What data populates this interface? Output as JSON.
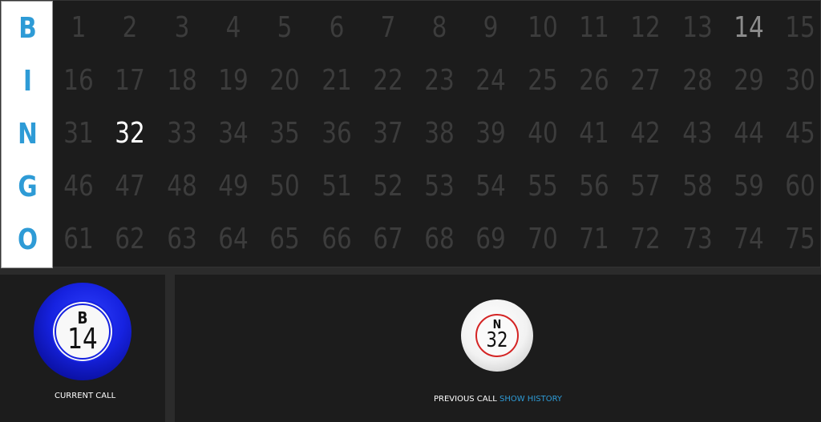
{
  "board": {
    "letters": [
      "B",
      "I",
      "N",
      "G",
      "O"
    ],
    "rows": [
      [
        "1",
        "2",
        "3",
        "4",
        "5",
        "6",
        "7",
        "8",
        "9",
        "10",
        "11",
        "12",
        "13",
        "14",
        "15"
      ],
      [
        "16",
        "17",
        "18",
        "19",
        "20",
        "21",
        "22",
        "23",
        "24",
        "25",
        "26",
        "27",
        "28",
        "29",
        "30"
      ],
      [
        "31",
        "32",
        "33",
        "34",
        "35",
        "36",
        "37",
        "38",
        "39",
        "40",
        "41",
        "42",
        "43",
        "44",
        "45"
      ],
      [
        "46",
        "47",
        "48",
        "49",
        "50",
        "51",
        "52",
        "53",
        "54",
        "55",
        "56",
        "57",
        "58",
        "59",
        "60"
      ],
      [
        "61",
        "62",
        "63",
        "64",
        "65",
        "66",
        "67",
        "68",
        "69",
        "70",
        "71",
        "72",
        "73",
        "74",
        "75"
      ]
    ],
    "called_numbers": [
      "14",
      "32"
    ],
    "current_number": "32"
  },
  "current_call": {
    "letter": "B",
    "number": "14",
    "label": "CURRENT CALL",
    "ball_color": "#1622e0"
  },
  "previous_call": {
    "letter": "N",
    "number": "32",
    "label": "PREVIOUS CALL",
    "ring_color": "#d42424"
  },
  "show_history_label": "SHOW HISTORY",
  "colors": {
    "accent": "#2e9bd6",
    "board_bg": "#1c1c1c",
    "uncalled": "#3c3c3c",
    "called": "#8c8c8c"
  }
}
